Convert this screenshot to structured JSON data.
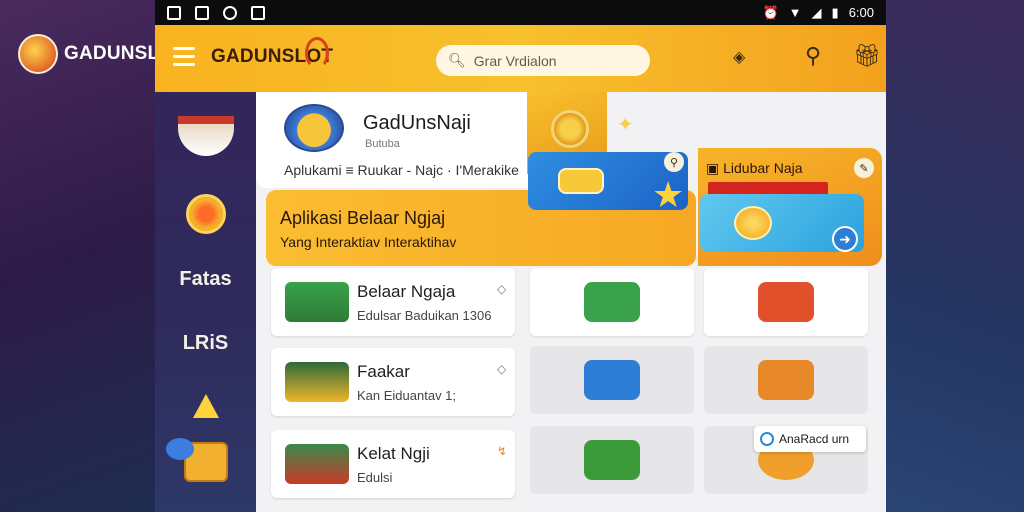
{
  "background": {
    "brand_text": "GADUNSLO",
    "colors": {
      "left": "#2d1b47",
      "right": "#243561"
    }
  },
  "status_bar": {
    "left_icons": [
      "gallery-icon",
      "image-icon",
      "whatsapp-icon",
      "translate-icon"
    ],
    "right_icons": [
      "alarm-icon",
      "wifi-icon",
      "signal-icon",
      "battery-icon"
    ],
    "time": "6:00"
  },
  "app_bar": {
    "title": "GADUNSLOT",
    "search_placeholder": "Grar Vrdialon",
    "accent": "#f9b320"
  },
  "sidebar": {
    "items": [
      {
        "name": "bowl",
        "icon": "food-bowl-icon"
      },
      {
        "name": "coin",
        "icon": "coin-icon"
      },
      {
        "name": "text1",
        "label": "Fatas"
      },
      {
        "name": "text2",
        "label": "LRiS"
      },
      {
        "name": "star",
        "icon": "star-icon"
      },
      {
        "name": "bag",
        "icon": "bag-icon"
      }
    ]
  },
  "header": {
    "app_name": "GadUnsNaji",
    "app_sub": "Butuba",
    "tags": "Aplukami ≡   Ruukar - Najc  ·  I'Merakike"
  },
  "banner": {
    "title": "Aplikasi Belaar Ngjaj",
    "subtitle": "Yang Interaktiav Interaktihav",
    "right_title": "Lidubar Naja",
    "blue_card_icon": "chat-bubble-icon",
    "arrow_icon": "arrow-right-icon"
  },
  "list": [
    {
      "title": "Belaar Ngaja",
      "subtitle": "Edulsar Baduikan 1306",
      "corner": "◇"
    },
    {
      "title": "Faakar",
      "subtitle": "Kan  Eiduantav  1;",
      "corner": "◇"
    },
    {
      "title": "Kelat Ngji",
      "subtitle": "Edulsi",
      "corner": "↯"
    }
  ],
  "tiles": [
    {
      "name": "chat-tile",
      "color": "#3aa24a"
    },
    {
      "name": "ribbon-tile",
      "color": "#e0502a"
    },
    {
      "name": "badge-tile",
      "color": "#2f7ed6"
    },
    {
      "name": "chest-tile",
      "color": "#e7892a"
    },
    {
      "name": "monitor-tile",
      "color": "#3b9a3a"
    },
    {
      "name": "coin-tile",
      "color": "#f0a02a"
    }
  ],
  "float_chip": {
    "label": "AnaRacd urn"
  }
}
